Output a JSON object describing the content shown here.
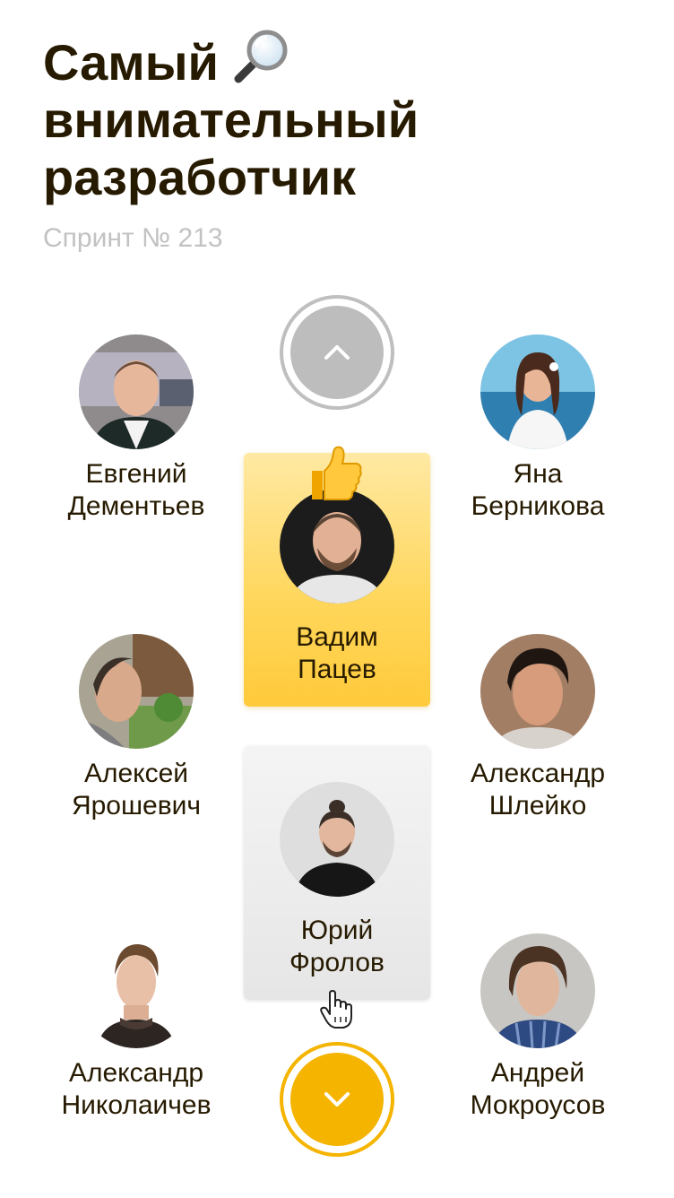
{
  "header": {
    "title_line1": "Самый",
    "title_line2": "внимательный",
    "title_line3": "разработчик",
    "title_emoji": "magnifying-glass-icon",
    "subtitle": "Спринт № 213"
  },
  "people": [
    {
      "name": "Евгений\nДементьев",
      "avatar": "avatar-photo"
    },
    {
      "name": "Яна\nБерникова",
      "avatar": "avatar-photo"
    },
    {
      "name": "Алексей\nЯрошевич",
      "avatar": "avatar-photo"
    },
    {
      "name": "Александр\nШлейко",
      "avatar": "avatar-photo"
    },
    {
      "name": "Александр\nНиколаичев",
      "avatar": "avatar-photo"
    },
    {
      "name": "Андрей\nМокроусов",
      "avatar": "avatar-photo"
    }
  ],
  "winner": {
    "name": "Вадим\nПацев",
    "badge": "thumbs-up-icon"
  },
  "selected": {
    "name": "Юрий\nФролов"
  },
  "navigation": {
    "up_icon": "chevron-up-icon",
    "down_icon": "chevron-down-icon"
  },
  "colors": {
    "accent": "#f5b400",
    "winner_card": "#ffd65a",
    "selected_card": "#ebebeb",
    "text": "#261a00",
    "subtitle": "#c2c2c2",
    "disabled_button": "#bdbdbd"
  }
}
